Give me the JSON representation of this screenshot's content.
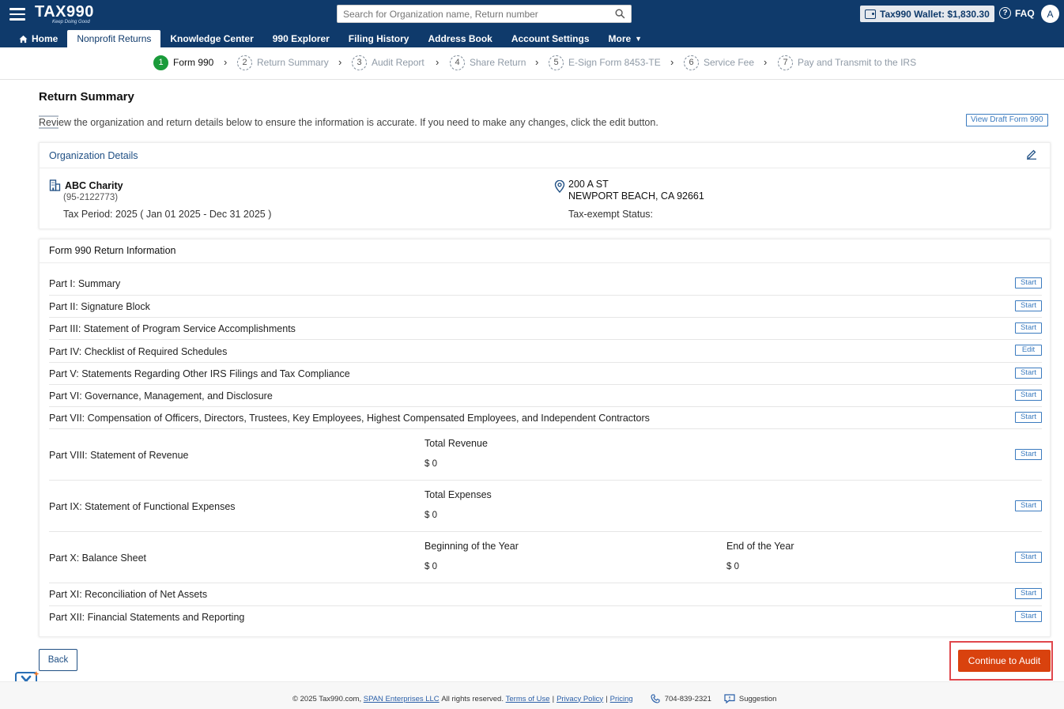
{
  "header": {
    "brand": "TAX990",
    "brand_tagline": "Keep Doing Good",
    "search_placeholder": "Search for Organization name, Return number",
    "wallet_label": "Tax990 Wallet: $1,830.30",
    "faq_label": "FAQ",
    "avatar_initial": "A"
  },
  "nav": {
    "items": [
      {
        "label": "Home"
      },
      {
        "label": "Nonprofit Returns"
      },
      {
        "label": "Knowledge Center"
      },
      {
        "label": "990 Explorer"
      },
      {
        "label": "Filing History"
      },
      {
        "label": "Address Book"
      },
      {
        "label": "Account Settings"
      },
      {
        "label": "More"
      }
    ],
    "active": "Nonprofit Returns"
  },
  "stepper": {
    "steps": [
      {
        "num": "1",
        "label": "Form 990"
      },
      {
        "num": "2",
        "label": "Return Summary"
      },
      {
        "num": "3",
        "label": "Audit Report"
      },
      {
        "num": "4",
        "label": "Share Return"
      },
      {
        "num": "5",
        "label": "E-Sign Form 8453-TE"
      },
      {
        "num": "6",
        "label": "Service Fee"
      },
      {
        "num": "7",
        "label": "Pay and Transmit to the IRS"
      }
    ],
    "active_step": "1"
  },
  "page": {
    "title": "Return Summary",
    "intro": "Review the organization and return details below to ensure the information is accurate. If you need to make any changes, click the edit button.",
    "view_draft_label": "View Draft Form 990"
  },
  "org": {
    "section_label": "Organization Details",
    "name": "ABC Charity",
    "ein": "(95-2122773)",
    "tax_period": "Tax Period: 2025 ( Jan 01 2025 - Dec 31 2025 )",
    "address_line1": "200 A ST",
    "address_line2": "NEWPORT BEACH, CA 92661",
    "tax_exempt_status": "Tax-exempt Status:"
  },
  "form": {
    "section_label": "Form 990 Return Information",
    "parts": [
      {
        "label": "Part I: Summary",
        "action": "Start"
      },
      {
        "label": "Part II: Signature Block",
        "action": "Start"
      },
      {
        "label": "Part III: Statement of Program Service Accomplishments",
        "action": "Start"
      },
      {
        "label": "Part IV: Checklist of Required Schedules",
        "action": "Edit"
      },
      {
        "label": "Part V:  Statements Regarding Other IRS Filings and Tax Compliance",
        "action": "Start"
      },
      {
        "label": "Part VI: Governance, Management, and Disclosure",
        "action": "Start"
      },
      {
        "label": "Part VII: Compensation of Officers, Directors, Trustees, Key Employees, Highest Compensated Employees, and Independent Contractors",
        "action": "Start"
      },
      {
        "label": "Part VIII: Statement of Revenue",
        "action": "Start",
        "col1_label": "Total Revenue",
        "col1_value": "$ 0"
      },
      {
        "label": "Part IX:   Statement of Functional Expenses",
        "action": "Start",
        "col1_label": "Total Expenses",
        "col1_value": "$ 0"
      },
      {
        "label": "Part X:    Balance Sheet",
        "action": "Start",
        "col1_label": "Beginning of the Year",
        "col1_value": "$ 0",
        "col2_label": "End of the Year",
        "col2_value": "$ 0"
      },
      {
        "label": "Part XI:   Reconciliation of Net Assets",
        "action": "Start"
      },
      {
        "label": "Part XII:  Financial Statements and Reporting",
        "action": "Start"
      }
    ]
  },
  "actions": {
    "back_label": "Back",
    "continue_label": "Continue to Audit"
  },
  "footer": {
    "copyright": "© 2025 Tax990.com,",
    "span_link": "SPAN Enterprises LLC",
    "rights": "All rights reserved.",
    "terms": "Terms of Use",
    "privacy": "Privacy Policy",
    "pricing": "Pricing",
    "phone": "704-839-2321",
    "suggestion": "Suggestion"
  },
  "colors": {
    "header_bg": "#0f3a6b",
    "accent_blue": "#3b7bbf",
    "step_active": "#1a9b3a",
    "continue_bg": "#d9420e",
    "highlight_border": "#e0474c"
  }
}
